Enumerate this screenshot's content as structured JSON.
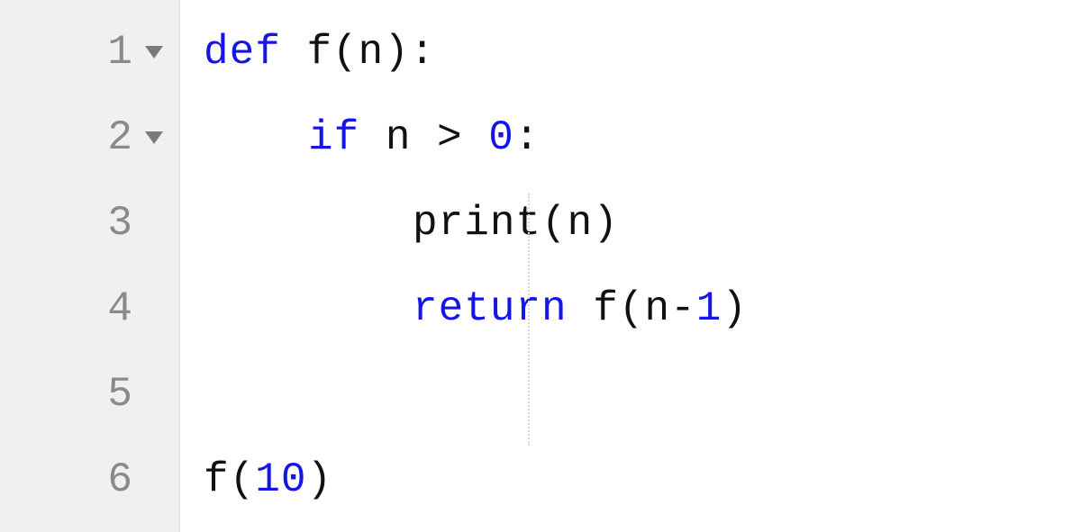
{
  "gutter": {
    "lines": [
      {
        "num": "1",
        "foldable": true
      },
      {
        "num": "2",
        "foldable": true
      },
      {
        "num": "3",
        "foldable": false
      },
      {
        "num": "4",
        "foldable": false
      },
      {
        "num": "5",
        "foldable": false
      },
      {
        "num": "6",
        "foldable": false
      }
    ]
  },
  "code": {
    "line1": {
      "kw_def": "def",
      "space1": " ",
      "fn_name": "f",
      "open_paren": "(",
      "param": "n",
      "close_paren": ")",
      "colon": ":"
    },
    "line2": {
      "kw_if": "if",
      "space1": " ",
      "var_n": "n",
      "space2": " ",
      "op_gt": ">",
      "space3": " ",
      "num_zero": "0",
      "colon": ":"
    },
    "line3": {
      "builtin_print": "print",
      "open_paren": "(",
      "var_n": "n",
      "close_paren": ")"
    },
    "line4": {
      "kw_return": "return",
      "space1": " ",
      "fn_name": "f",
      "open_paren": "(",
      "var_n": "n",
      "op_minus": "-",
      "num_one": "1",
      "close_paren": ")"
    },
    "line5": {
      "blank": ""
    },
    "line6": {
      "fn_name": "f",
      "open_paren": "(",
      "num_ten": "10",
      "close_paren": ")"
    }
  }
}
